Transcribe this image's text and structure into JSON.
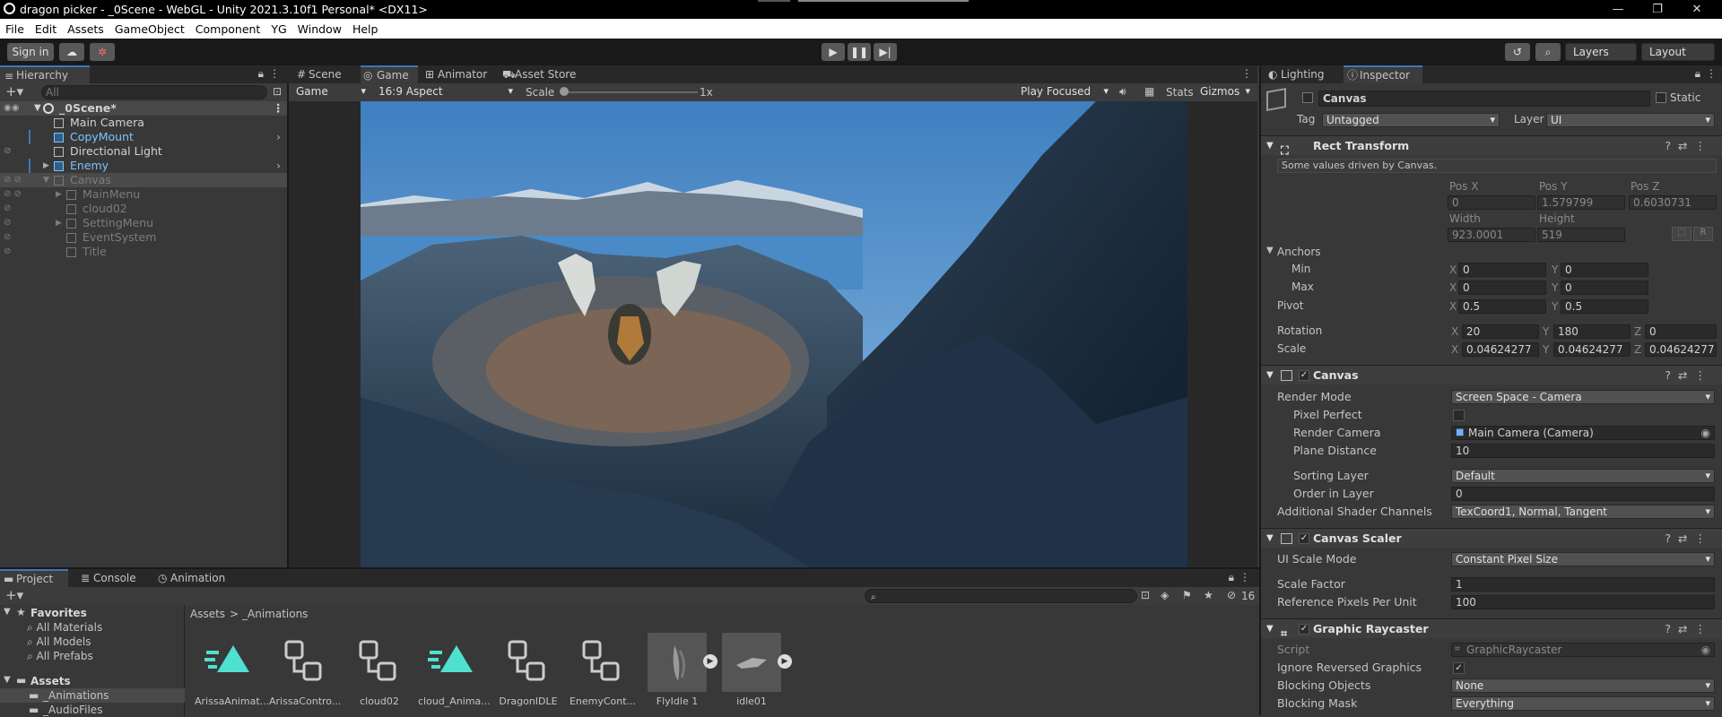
{
  "window": {
    "title": "dragon picker - _0Scene - WebGL - Unity 2021.3.10f1 Personal* <DX11>",
    "min": "—",
    "restore": "❐",
    "close": "✕"
  },
  "menu": [
    "File",
    "Edit",
    "Assets",
    "GameObject",
    "Component",
    "YG",
    "Window",
    "Help"
  ],
  "toolbar": {
    "sign_in": "Sign in",
    "layers": "Layers",
    "layout": "Layout"
  },
  "hierarchy": {
    "tab": "Hierarchy",
    "search_placeholder": "All",
    "items": [
      {
        "label": "_0Scene*",
        "style": "scene"
      },
      {
        "label": "Main Camera",
        "style": "normal"
      },
      {
        "label": "CopyMount",
        "style": "blue"
      },
      {
        "label": "Directional Light",
        "style": "normal"
      },
      {
        "label": "Enemy",
        "style": "blue"
      },
      {
        "label": "Canvas",
        "style": "dim"
      },
      {
        "label": "MainMenu",
        "style": "dim"
      },
      {
        "label": "cloud02",
        "style": "dim"
      },
      {
        "label": "SettingMenu",
        "style": "dim"
      },
      {
        "label": "EventSystem",
        "style": "dim"
      },
      {
        "label": "Title",
        "style": "dim"
      }
    ]
  },
  "center_tabs": [
    "Scene",
    "Game",
    "Animator",
    "Asset Store"
  ],
  "game_bar": {
    "display": "Game",
    "aspect": "16:9 Aspect",
    "scale_label": "Scale",
    "scale_value": "1x",
    "play_mode": "Play Focused",
    "stats": "Stats",
    "gizmos": "Gizmos"
  },
  "inspector": {
    "tabs": [
      "Lighting",
      "Inspector"
    ],
    "object_name": "Canvas",
    "static_label": "Static",
    "tag_label": "Tag",
    "tag_value": "Untagged",
    "layer_label": "Layer",
    "layer_value": "UI",
    "rect": {
      "title": "Rect Transform",
      "note": "Some values driven by Canvas.",
      "posx_label": "Pos X",
      "posy_label": "Pos Y",
      "posz_label": "Pos Z",
      "posx": "0",
      "posy": "1.579799",
      "posz": "0.6030731",
      "width_label": "Width",
      "height_label": "Height",
      "width": "923.0001",
      "height": "519",
      "anchors": "Anchors",
      "min": "Min",
      "max": "Max",
      "min_x": "0",
      "min_y": "0",
      "max_x": "0",
      "max_y": "0",
      "pivot": "Pivot",
      "pivot_x": "0.5",
      "pivot_y": "0.5",
      "rotation": "Rotation",
      "rot_x": "20",
      "rot_y": "180",
      "rot_z": "0",
      "scale": "Scale",
      "sc_x": "0.04624277",
      "sc_y": "0.04624277",
      "sc_z": "0.04624277",
      "r_btn": "R"
    },
    "canvas": {
      "title": "Canvas",
      "render_mode_label": "Render Mode",
      "render_mode": "Screen Space - Camera",
      "pixel_perfect": "Pixel Perfect",
      "render_camera_label": "Render Camera",
      "render_camera": "Main Camera (Camera)",
      "plane_distance_label": "Plane Distance",
      "plane_distance": "10",
      "sorting_layer_label": "Sorting Layer",
      "sorting_layer": "Default",
      "order_label": "Order in Layer",
      "order": "0",
      "shader_label": "Additional Shader Channels",
      "shader": "TexCoord1, Normal, Tangent"
    },
    "scaler": {
      "title": "Canvas Scaler",
      "mode_label": "UI Scale Mode",
      "mode": "Constant Pixel Size",
      "factor_label": "Scale Factor",
      "factor": "1",
      "ppu_label": "Reference Pixels Per Unit",
      "ppu": "100"
    },
    "raycaster": {
      "title": "Graphic Raycaster",
      "script_label": "Script",
      "script": "GraphicRaycaster",
      "ignore_label": "Ignore Reversed Graphics",
      "blocking_label": "Blocking Objects",
      "blocking": "None",
      "mask_label": "Blocking Mask",
      "mask": "Everything"
    }
  },
  "project": {
    "tabs": [
      "Project",
      "Console",
      "Animation"
    ],
    "favorites": "Favorites",
    "fav_items": [
      "All Materials",
      "All Models",
      "All Prefabs"
    ],
    "assets": "Assets",
    "folders": [
      "_Animations",
      "_AudioFiles"
    ],
    "breadcrumb_root": "Assets",
    "breadcrumb_sep": ">",
    "breadcrumb_leaf": "_Animations",
    "hidden_count": "16",
    "assets_list": [
      {
        "label": "ArissaAnimat...",
        "kind": "anim"
      },
      {
        "label": "ArissaContro...",
        "kind": "ctrl"
      },
      {
        "label": "cloud02",
        "kind": "ctrl"
      },
      {
        "label": "cloud_Anima...",
        "kind": "anim"
      },
      {
        "label": "DragonIDLE",
        "kind": "ctrl"
      },
      {
        "label": "EnemyCont...",
        "kind": "ctrl"
      },
      {
        "label": "FlyIdle 1",
        "kind": "clip"
      },
      {
        "label": "idle01",
        "kind": "clip"
      }
    ]
  },
  "colors": {
    "accent": "#3a79bb",
    "anim_teal": "#4fe0d0",
    "prefab_blue": "#7bc4ff"
  }
}
